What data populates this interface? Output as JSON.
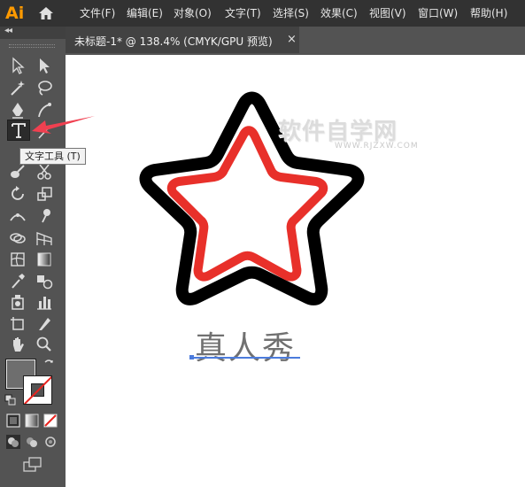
{
  "app": {
    "logo": "Ai",
    "home_icon": "home-icon"
  },
  "menu": [
    "文件(F)",
    "编辑(E)",
    "对象(O)",
    "文字(T)",
    "选择(S)",
    "效果(C)",
    "视图(V)",
    "窗口(W)",
    "帮助(H)"
  ],
  "document_tab": {
    "title": "未标题-1* @ 138.4% (CMYK/GPU 预览)",
    "close": "×"
  },
  "tools_panel": {
    "collapse": "◂◂",
    "tooltip": "文字工具 (T)",
    "active_tool": "type-tool"
  },
  "canvas": {
    "text": "真人秀",
    "watermark": {
      "main": "软件自学网",
      "sub": "WWW.RJZXW.COM"
    },
    "star_outer_color": "#000000",
    "star_inner_color": "#e8302a",
    "annotation_arrow_color": "#f04050"
  },
  "colors": {
    "fill": "#6e6e6e",
    "stroke": "none"
  }
}
